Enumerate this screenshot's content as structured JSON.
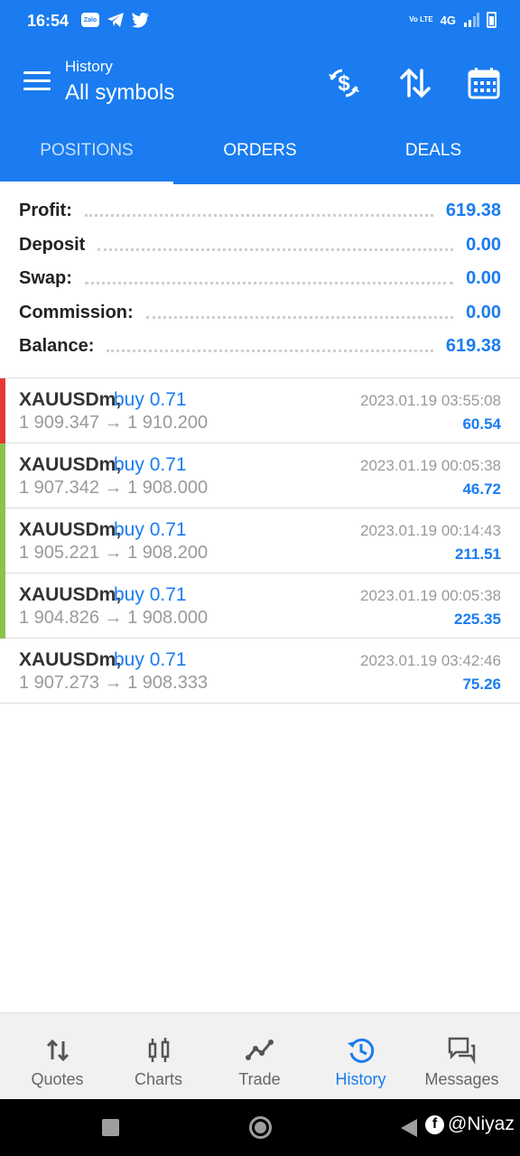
{
  "status_bar": {
    "time": "16:54",
    "zalo_label": "Zalo",
    "volte": "Vo LTE",
    "network": "4G"
  },
  "header": {
    "subtitle": "History",
    "title": "All symbols",
    "icons": [
      "currency-exchange-icon",
      "sort-icon",
      "calendar-icon"
    ]
  },
  "tabs": [
    {
      "label": "POSITIONS",
      "active": true
    },
    {
      "label": "ORDERS",
      "active": false
    },
    {
      "label": "DEALS",
      "active": false
    }
  ],
  "summary": [
    {
      "label": "Profit:",
      "value": "619.38"
    },
    {
      "label": "Deposit",
      "value": "0.00"
    },
    {
      "label": "Swap:",
      "value": "0.00"
    },
    {
      "label": "Commission:",
      "value": "0.00"
    },
    {
      "label": "Balance:",
      "value": "619.38"
    }
  ],
  "deals": [
    {
      "symbol": "XAUUSDm,",
      "type": "buy 0.71",
      "open_price": "1 909.347",
      "close_price": "1 910.200",
      "time": "2023.01.19 03:55:08",
      "profit": "60.54",
      "marker_color": "#e53935"
    },
    {
      "symbol": "XAUUSDm,",
      "type": "buy 0.71",
      "open_price": "1 907.342",
      "close_price": "1 908.000",
      "time": "2023.01.19 00:05:38",
      "profit": "46.72",
      "marker_color": "#8bc34a"
    },
    {
      "symbol": "XAUUSDm,",
      "type": "buy 0.71",
      "open_price": "1 905.221",
      "close_price": "1 908.200",
      "time": "2023.01.19 00:14:43",
      "profit": "211.51",
      "marker_color": "#8bc34a"
    },
    {
      "symbol": "XAUUSDm,",
      "type": "buy 0.71",
      "open_price": "1 904.826",
      "close_price": "1 908.000",
      "time": "2023.01.19 00:05:38",
      "profit": "225.35",
      "marker_color": "#8bc34a"
    },
    {
      "symbol": "XAUUSDm,",
      "type": "buy 0.71",
      "open_price": "1 907.273",
      "close_price": "1 908.333",
      "time": "2023.01.19 03:42:46",
      "profit": "75.26",
      "marker_color": ""
    }
  ],
  "arrow": "→",
  "bottom_nav": [
    {
      "label": "Quotes",
      "icon": "quotes-icon",
      "active": false
    },
    {
      "label": "Charts",
      "icon": "charts-icon",
      "active": false
    },
    {
      "label": "Trade",
      "icon": "trade-icon",
      "active": false
    },
    {
      "label": "History",
      "icon": "history-icon",
      "active": true
    },
    {
      "label": "Messages",
      "icon": "messages-icon",
      "active": false
    }
  ],
  "watermark": "@Niyaz",
  "colors": {
    "primary": "#1a7cf0",
    "loss_marker": "#e53935",
    "profit_marker": "#8bc34a"
  }
}
